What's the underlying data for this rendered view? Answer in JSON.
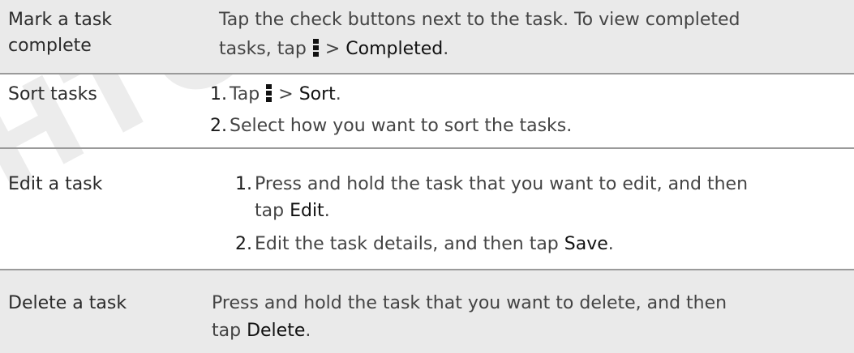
{
  "watermark": "HTC Confidential",
  "rows": [
    {
      "label_line1": "Mark a task",
      "label_line2": "complete",
      "line1": "Tap the check buttons next to the task. To view completed",
      "line2_pre": "tasks, tap",
      "line2_sep": ">",
      "line2_ui": "Completed",
      "line2_end": ".",
      "icon": "menu-icon"
    },
    {
      "label": "Sort tasks",
      "step1_num": "1.",
      "step1_pre": "Tap",
      "step1_sep": ">",
      "step1_ui": "Sort",
      "step1_end": ".",
      "step2_num": "2.",
      "step2_text": "Select how you want to sort the tasks.",
      "icon": "menu-icon"
    },
    {
      "label": "Edit a task",
      "step1_num": "1.",
      "step1_line1": "Press and hold the task that you want to edit, and then",
      "step1_line2_pre": "tap",
      "step1_line2_ui": "Edit",
      "step1_line2_end": ".",
      "step2_num": "2.",
      "step2_pre": "Edit the task details, and then tap",
      "step2_ui": "Save",
      "step2_end": "."
    },
    {
      "label": "Delete a task",
      "line1": "Press and hold the task that you want to delete, and then",
      "line2_pre": "tap",
      "line2_ui": "Delete",
      "line2_end": "."
    }
  ]
}
